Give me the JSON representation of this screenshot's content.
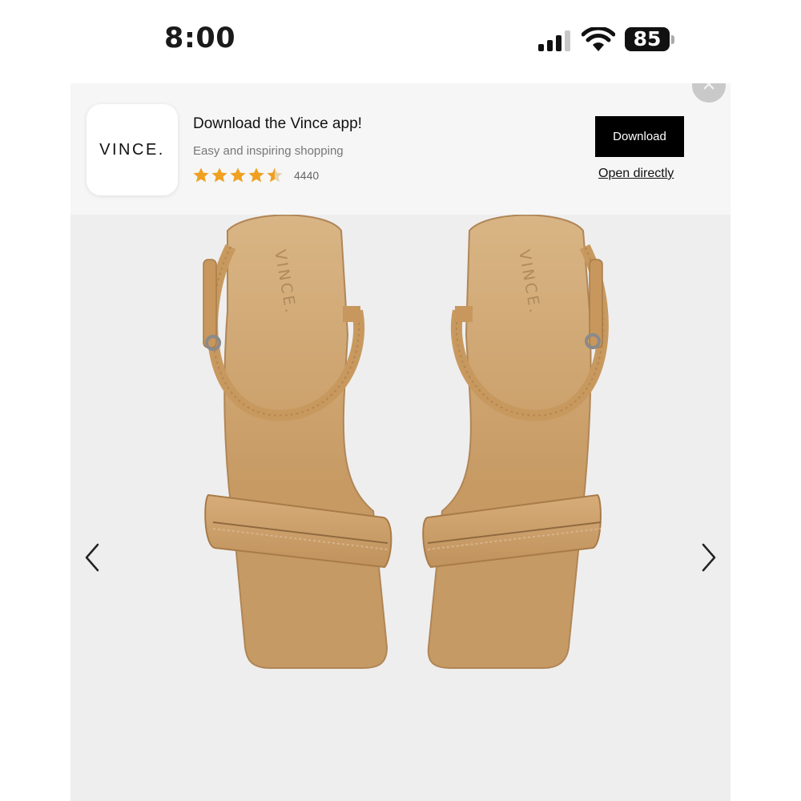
{
  "status_bar": {
    "time": "8:00",
    "battery": "85",
    "icons": [
      "signal-icon",
      "wifi-icon",
      "battery-icon"
    ]
  },
  "app_banner": {
    "close_icon": "close-icon",
    "app_icon_text": "VINCE.",
    "title": "Download the Vince app!",
    "subtitle": "Easy and inspiring shopping",
    "rating": 4.5,
    "rating_count": "4440",
    "download_label": "Download",
    "open_label": "Open directly",
    "colors": {
      "star": "#f0a020",
      "button_bg": "#000000"
    }
  },
  "product_gallery": {
    "image_description": "tan-leather-sandal-pair",
    "prev_icon": "chevron-left-icon",
    "next_icon": "chevron-right-icon",
    "colors": {
      "background": "#efeeee",
      "leather": "#c9a06e"
    }
  }
}
